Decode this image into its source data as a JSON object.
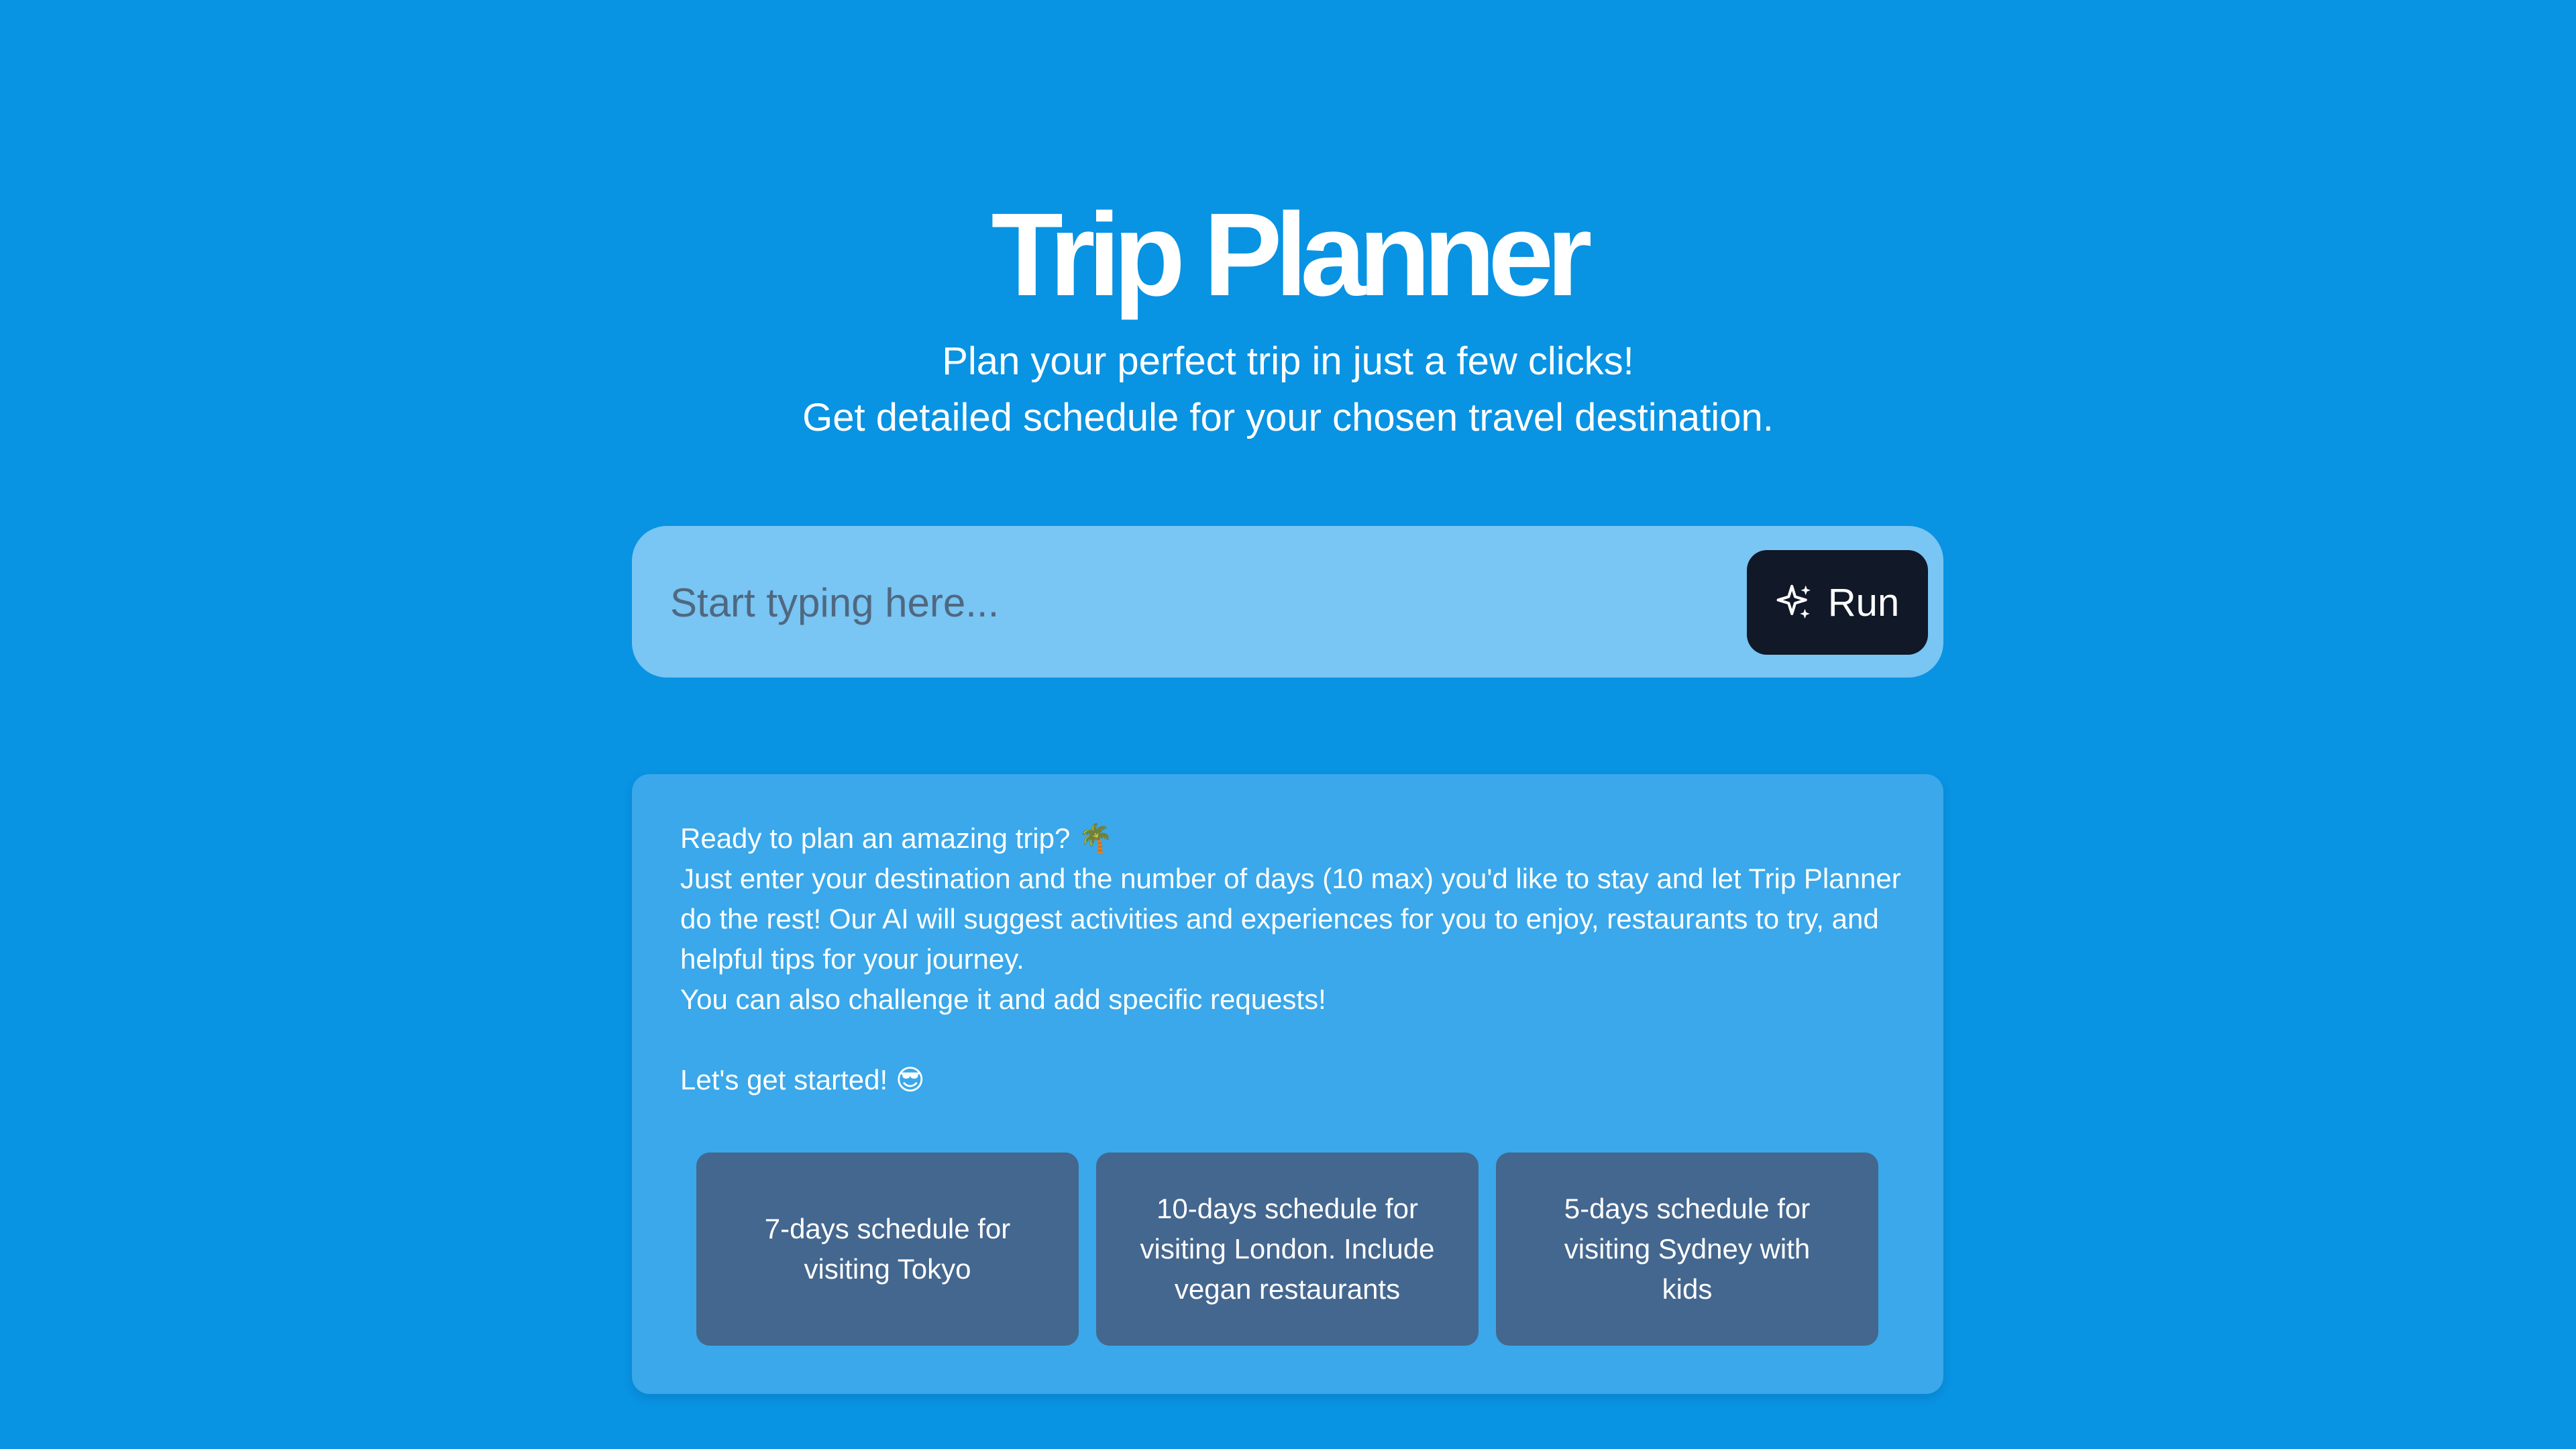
{
  "header": {
    "title": "Trip Planner",
    "subtitle_line1": "Plan your perfect trip in just a few clicks!",
    "subtitle_line2": "Get detailed schedule for your chosen travel destination."
  },
  "search": {
    "placeholder": "Start typing here...",
    "value": "",
    "run_label": "Run",
    "run_icon": "sparkles-icon"
  },
  "info": {
    "line1": "Ready to plan an amazing trip? 🌴",
    "line2": "Just enter your destination and the number of days (10 max) you'd like to stay and let Trip Planner do the rest! Our AI will suggest activities and experiences for you to enjoy, restaurants to try, and helpful tips for your journey.",
    "line3": "You can also challenge it and add specific requests!",
    "line4": "Let's get started! 😎"
  },
  "suggestions": [
    {
      "label": "7-days schedule for visiting Tokyo"
    },
    {
      "label": "10-days schedule for visiting London. Include vegan restaurants"
    },
    {
      "label": "5-days schedule for visiting Sydney with kids"
    }
  ],
  "colors": {
    "background": "#0993e3",
    "search_box": "#79c5f3",
    "run_button": "#111827",
    "info_card": "#3aa8ea",
    "suggestion": "#44678f"
  }
}
